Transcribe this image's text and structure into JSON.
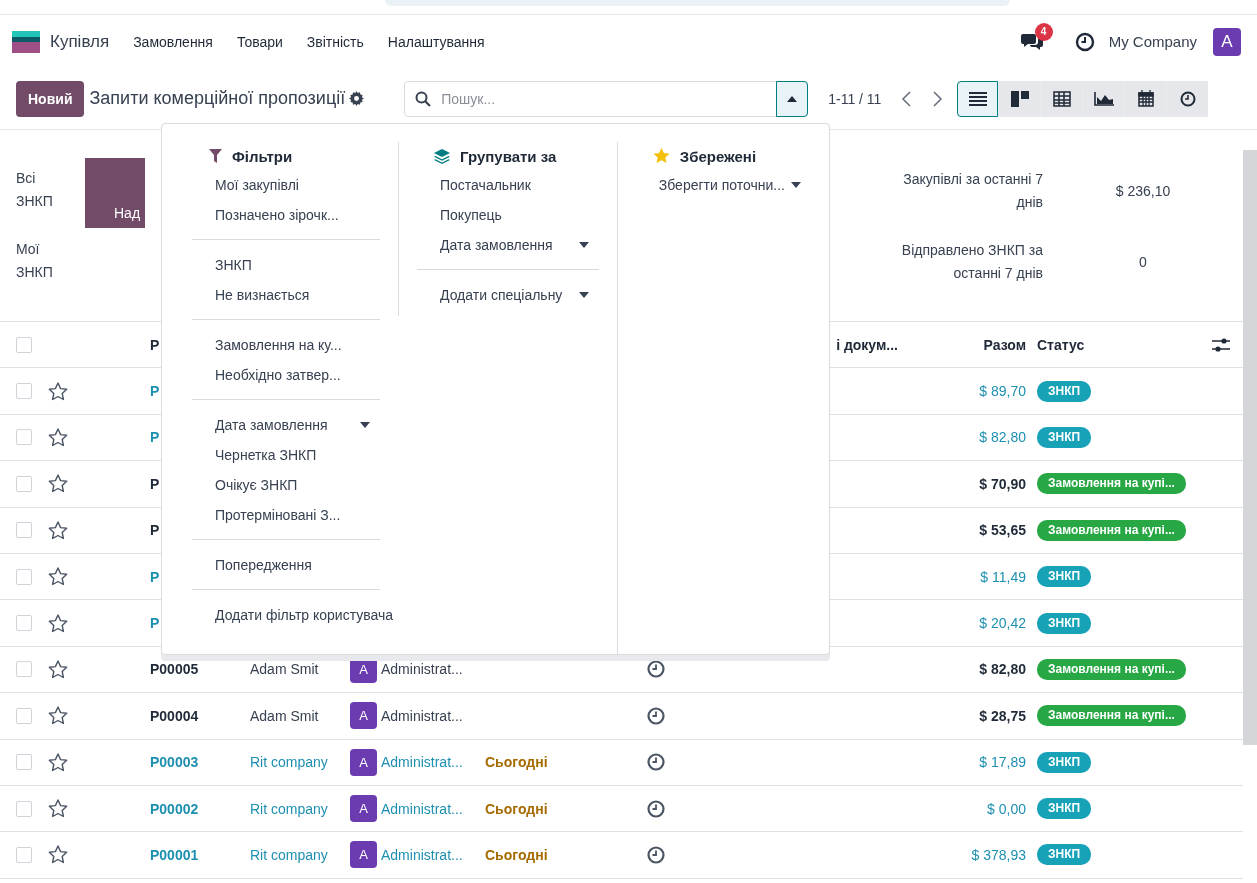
{
  "navbar": {
    "app_name": "Купівля",
    "menus": [
      "Замовлення",
      "Товари",
      "Звітність",
      "Налаштування"
    ],
    "messages_badge": "4",
    "company": "My Company",
    "avatar": "A"
  },
  "control_panel": {
    "new_button": "Новий",
    "title": "Запити комерційної пропозиції",
    "search": {
      "placeholder": "Пошук...",
      "expanded": true
    },
    "pager": "1-11 / 11",
    "views": [
      {
        "kind": "list",
        "selected": true
      },
      {
        "kind": "kanban",
        "selected": false
      },
      {
        "kind": "pivot",
        "selected": false
      },
      {
        "kind": "graph",
        "selected": false
      },
      {
        "kind": "calendar",
        "selected": false
      },
      {
        "kind": "activity",
        "selected": false
      }
    ]
  },
  "dashboard": {
    "shortcuts": [
      "Всі ЗНКП",
      "Мої ЗНКП"
    ],
    "tile": "Над",
    "stats": [
      {
        "label": "Закупівлі за останні 7 днів",
        "value": "$ 236,10"
      },
      {
        "label": "Відправлено ЗНКП за останні 7 днів",
        "value": "0"
      }
    ]
  },
  "search_panel": {
    "filters": {
      "title": "Фільтри",
      "groups": [
        [
          {
            "label": "Мої закупівлі",
            "selected": false
          },
          {
            "label": "Позначено зірочк...",
            "selected": false
          }
        ],
        [
          {
            "label": "ЗНКП",
            "selected": false
          },
          {
            "label": "Не визнається",
            "selected": false
          }
        ],
        [
          {
            "label": "Замовлення на ку...",
            "selected": false
          },
          {
            "label": "Необхідно затвер...",
            "selected": false
          }
        ],
        [
          {
            "label": "Дата замовлення",
            "selected": false,
            "has_options": true
          },
          {
            "label": "Чернетка ЗНКП",
            "selected": false
          },
          {
            "label": "Очікує ЗНКП",
            "selected": false
          },
          {
            "label": "Протерміновані З...",
            "selected": false
          }
        ],
        [
          {
            "label": "Попередження",
            "selected": false
          }
        ],
        [
          {
            "label": "Додати фільтр користувача",
            "selected": false
          }
        ]
      ]
    },
    "group_by": {
      "title": "Групувати за",
      "groups": [
        [
          {
            "label": "Постачальник",
            "selected": false
          },
          {
            "label": "Покупець",
            "selected": false
          },
          {
            "label": "Дата замовлення",
            "selected": false,
            "has_options": true
          }
        ],
        [
          {
            "label": "Додати спеціальну",
            "selected": false,
            "has_options": true
          }
        ]
      ]
    },
    "favorites": {
      "title": "Збережені",
      "groups": [
        [
          {
            "label": "Зберегти поточни...",
            "selected": false,
            "has_options": true
          }
        ]
      ]
    }
  },
  "table": {
    "select_all_checked": false,
    "columns": {
      "reference": "Р",
      "document": "і докум...",
      "total": "Разом",
      "status": "Статус"
    },
    "rows": [
      {
        "kind": "rfq",
        "reference": "P",
        "checked": false,
        "total": "$ 89,70",
        "status": {
          "label": "ЗНКП",
          "color": "#17a2b8"
        }
      },
      {
        "kind": "rfq",
        "reference": "P",
        "checked": false,
        "total": "$ 82,80",
        "status": {
          "label": "ЗНКП",
          "color": "#17a2b8"
        }
      },
      {
        "kind": "order",
        "reference": "P",
        "checked": false,
        "total": "$ 70,90",
        "status": {
          "label": "Замовлення на купі...",
          "color": "#28a745"
        }
      },
      {
        "kind": "order",
        "reference": "P",
        "checked": false,
        "total": "$ 53,65",
        "status": {
          "label": "Замовлення на купі...",
          "color": "#28a745"
        }
      },
      {
        "kind": "rfq",
        "reference": "P",
        "checked": false,
        "total": "$ 11,49",
        "status": {
          "label": "ЗНКП",
          "color": "#17a2b8"
        }
      },
      {
        "kind": "rfq",
        "reference": "P",
        "checked": false,
        "total": "$ 20,42",
        "status": {
          "label": "ЗНКП",
          "color": "#17a2b8"
        }
      },
      {
        "kind": "order",
        "reference": "P00005",
        "vendor": "Adam Smit",
        "buyer_avatar": "A",
        "buyer": "Administrat...",
        "checked": false,
        "activity": true,
        "total": "$ 82,80",
        "status": {
          "label": "Замовлення на купі...",
          "color": "#28a745"
        }
      },
      {
        "kind": "order",
        "reference": "P00004",
        "vendor": "Adam Smit",
        "buyer_avatar": "A",
        "buyer": "Administrat...",
        "checked": false,
        "activity": true,
        "total": "$ 28,75",
        "status": {
          "label": "Замовлення на купі...",
          "color": "#28a745"
        }
      },
      {
        "kind": "rfq",
        "reference": "P00003",
        "vendor": "Rit company",
        "buyer_avatar": "A",
        "buyer": "Administrat...",
        "date": "Сьогодні",
        "checked": false,
        "activity": true,
        "total": "$ 17,89",
        "status": {
          "label": "ЗНКП",
          "color": "#17a2b8"
        }
      },
      {
        "kind": "rfq",
        "reference": "P00002",
        "vendor": "Rit company",
        "buyer_avatar": "A",
        "buyer": "Administrat...",
        "date": "Сьогодні",
        "checked": false,
        "activity": true,
        "total": "$ 0,00",
        "status": {
          "label": "ЗНКП",
          "color": "#17a2b8"
        }
      },
      {
        "kind": "rfq",
        "reference": "P00001",
        "vendor": "Rit company",
        "buyer_avatar": "A",
        "buyer": "Administrat...",
        "date": "Сьогодні",
        "checked": false,
        "activity": true,
        "total": "$ 378,93",
        "status": {
          "label": "ЗНКП",
          "color": "#17a2b8"
        }
      }
    ]
  }
}
